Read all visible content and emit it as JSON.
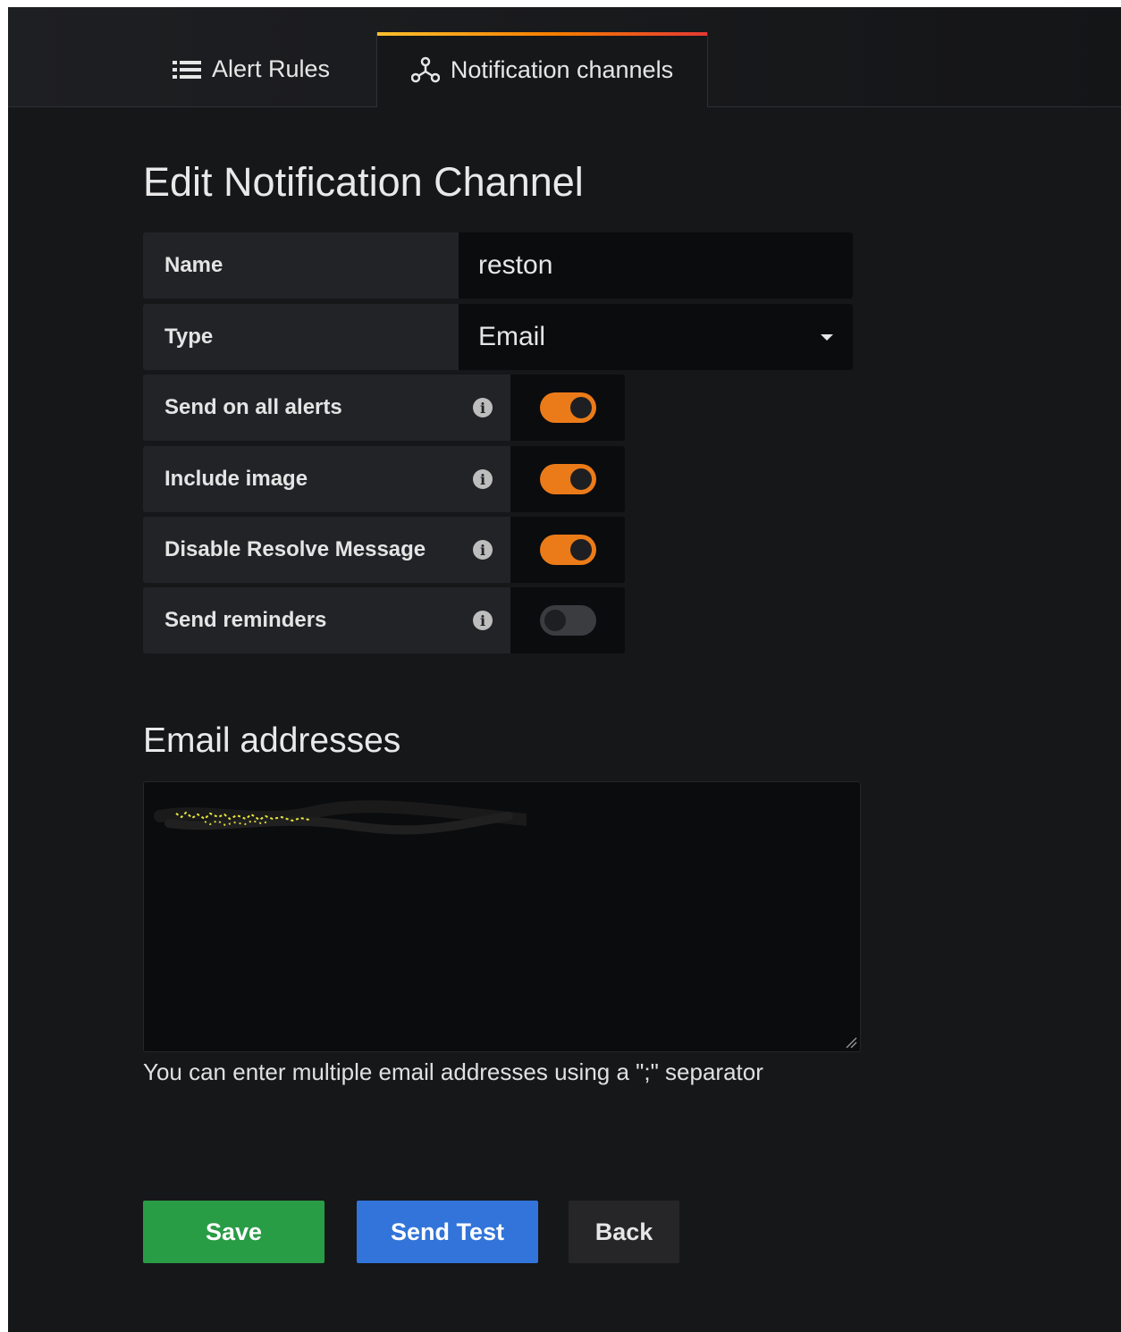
{
  "tabs": [
    {
      "label": "Alert Rules",
      "icon": "list-icon",
      "active": false
    },
    {
      "label": "Notification channels",
      "icon": "channels-icon",
      "active": true
    }
  ],
  "page_title": "Edit Notification Channel",
  "form": {
    "name": {
      "label": "Name",
      "value": "reston"
    },
    "type": {
      "label": "Type",
      "value": "Email"
    },
    "switches": [
      {
        "label": "Send on all alerts",
        "on": true
      },
      {
        "label": "Include image",
        "on": true
      },
      {
        "label": "Disable Resolve Message",
        "on": true
      },
      {
        "label": "Send reminders",
        "on": false
      }
    ]
  },
  "email_section": {
    "title": "Email addresses",
    "help": "You can enter multiple email addresses using a \";\" separator"
  },
  "buttons": {
    "save": "Save",
    "send_test": "Send Test",
    "back": "Back"
  },
  "colors": {
    "toggle_on": "#eb7b18",
    "toggle_off": "#3b3c40",
    "save": "#299c46",
    "send_test": "#3274d9",
    "background": "#161719"
  }
}
